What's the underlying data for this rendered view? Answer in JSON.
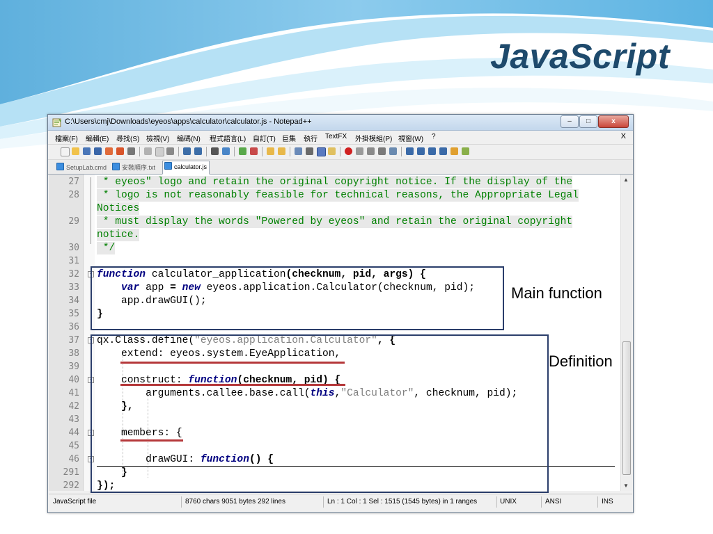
{
  "slide": {
    "title": "JavaScript"
  },
  "window": {
    "title": "C:\\Users\\cmj\\Downloads\\eyeos\\apps\\calculator\\calculator.js - Notepad++",
    "buttons": {
      "minimize": "–",
      "maximize": "□",
      "close": "x"
    },
    "menu_close": "X"
  },
  "menu": [
    "檔案(F)",
    "編輯(E)",
    "尋找(S)",
    "檢視(V)",
    "編碼(N)",
    "程式語言(L)",
    "自訂(T)",
    "巨集",
    "執行",
    "TextFX",
    "外掛模組(P)",
    "視窗(W)",
    "?"
  ],
  "tabs": [
    {
      "label": "SetupLab.cmd",
      "active": false
    },
    {
      "label": "安裝順序.txt",
      "active": false
    },
    {
      "label": "calculator.js",
      "active": true
    }
  ],
  "line_numbers": [
    "27",
    "28",
    "",
    "29",
    "",
    "30",
    "31",
    "32",
    "33",
    "34",
    "35",
    "36",
    "37",
    "38",
    "39",
    "40",
    "41",
    "42",
    "43",
    "44",
    "45",
    "46",
    "291",
    "292"
  ],
  "code": {
    "l27": " * eyeos\" logo and retain the original copyright notice. If the display of the",
    "l28a": " * logo is not reasonably feasible for technical reasons, the Appropriate Legal",
    "l28b": "Notices",
    "l29a": " * must display the words \"Powered by eyeos\" and retain the original copyright",
    "l29b": "notice.",
    "l30": " */",
    "l32_kw": "function",
    "l32_rest": " calculator_application",
    "l32_args": "(checknum, pid, args) {",
    "l33_kw1": "var",
    "l33_mid1": " app ",
    "l33_eq": "=",
    "l33_kw2": "new",
    "l33_rest": " eyeos.application.Calculator(checknum, pid);",
    "l34": "app.drawGUI();",
    "l35": "}",
    "l37_a": "qx.Class.define(",
    "l37_str": "\"eyeos.application.Calculator\"",
    "l37_b": ", {",
    "l38": "extend: eyeos.system.EyeApplication,",
    "l40_a": "construct: ",
    "l40_kw": "function",
    "l40_b": "(checknum, pid) {",
    "l41_a": "arguments.callee.base.call(",
    "l41_kw": "this",
    "l41_str": "\"Calculator\"",
    "l41_b": ", checknum, pid);",
    "l42": "},",
    "l44": "members: {",
    "l46_a": "drawGUI: ",
    "l46_kw": "function",
    "l46_b": "() {",
    "l291": "}",
    "l292": "});"
  },
  "status": {
    "file_type": "JavaScript file",
    "counts": "8760 chars  9051 bytes  292 lines",
    "position": "Ln : 1   Col : 1   Sel : 1515 (1545 bytes) in 1 ranges",
    "eol": "UNIX",
    "encoding": "ANSI",
    "mode": "INS"
  },
  "annotations": {
    "main_function": "Main function",
    "definition": "Definition"
  },
  "colors": {
    "title": "#1e4a6c",
    "annotation_box": "#2b3e6b",
    "underline": "#b5383a",
    "comment": "#008000",
    "keyword": "#000080"
  }
}
